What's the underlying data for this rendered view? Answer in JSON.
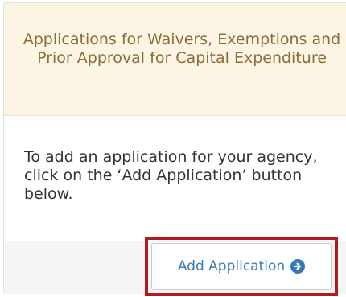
{
  "panel": {
    "title": "Applications for Waivers, Exemptions and Prior Approval for Capital Expenditure",
    "body_text": "To add an application for your agency, click on the ‘Add Application’ button below.",
    "button_label": "Add Application",
    "button_icon": "arrow-circle-right-icon"
  },
  "colors": {
    "header_bg": "#fcf5e4",
    "title_text": "#8a6d3b",
    "body_text": "#333333",
    "footer_bg": "#f5f5f5",
    "button_text": "#337ab7",
    "highlight_border": "#b01b22"
  }
}
